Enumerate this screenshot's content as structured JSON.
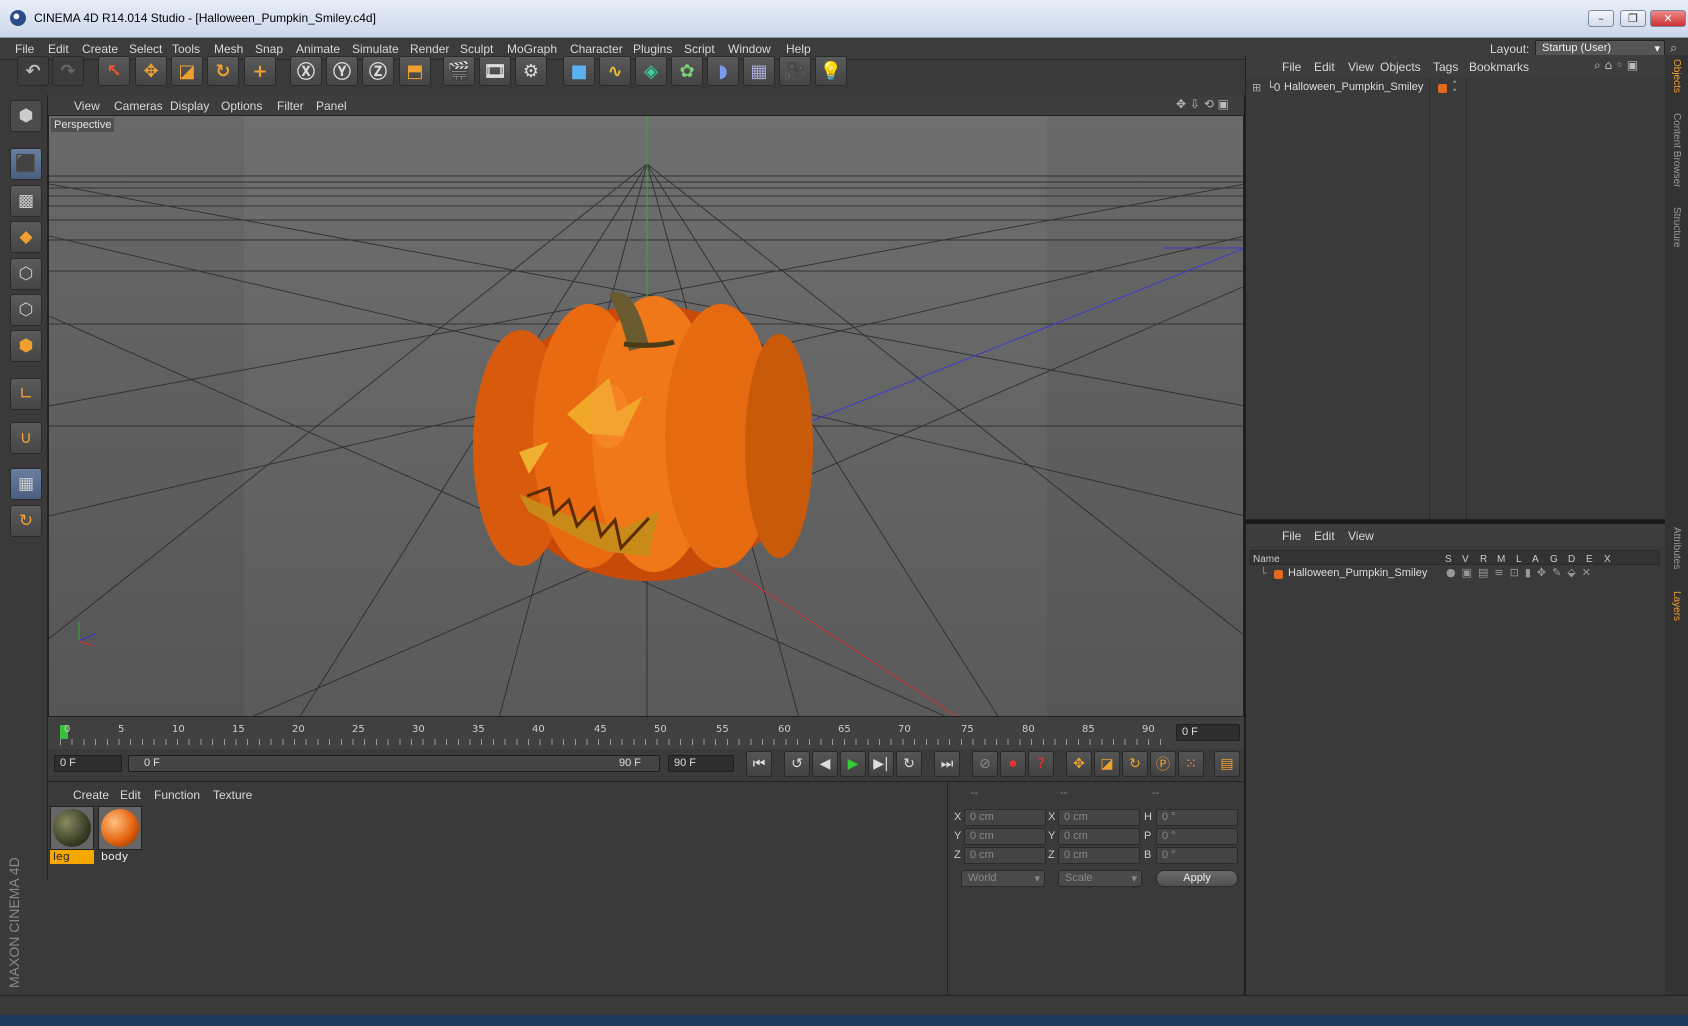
{
  "window": {
    "title": "CINEMA 4D R14.014 Studio - [Halloween_Pumpkin_Smiley.c4d]",
    "controls": [
      "minimize",
      "restore",
      "close"
    ]
  },
  "menubar": {
    "items": [
      "File",
      "Edit",
      "Create",
      "Select",
      "Tools",
      "Mesh",
      "Snap",
      "Animate",
      "Simulate",
      "Render",
      "Sculpt",
      "MoGraph",
      "Character",
      "Plugins",
      "Script",
      "Window",
      "Help"
    ],
    "layout_label": "Layout:",
    "layout_value": "Startup (User)"
  },
  "viewport": {
    "menu": [
      "View",
      "Cameras",
      "Display",
      "Options",
      "Filter",
      "Panel"
    ],
    "label": "Perspective"
  },
  "timeline": {
    "ticks": [
      "0",
      "5",
      "10",
      "15",
      "20",
      "25",
      "30",
      "35",
      "40",
      "45",
      "50",
      "55",
      "60",
      "65",
      "70",
      "75",
      "80",
      "85",
      "90"
    ],
    "current_frame": "0 F",
    "start_field": "0 F",
    "range_start": "0 F",
    "range_end": "90 F",
    "end_field": "90 F"
  },
  "materials": {
    "menu": [
      "Create",
      "Edit",
      "Function",
      "Texture"
    ],
    "items": [
      {
        "name": "leg",
        "selected": true,
        "color": "#3a3f28"
      },
      {
        "name": "body",
        "selected": false,
        "color": "#e5640f"
      }
    ]
  },
  "coordinates": {
    "headers": [
      "--",
      "--",
      "--"
    ],
    "rows": [
      {
        "l1": "X",
        "v1": "0 cm",
        "l2": "X",
        "v2": "0 cm",
        "l3": "H",
        "v3": "0 °"
      },
      {
        "l1": "Y",
        "v1": "0 cm",
        "l2": "Y",
        "v2": "0 cm",
        "l3": "P",
        "v3": "0 °"
      },
      {
        "l1": "Z",
        "v1": "0 cm",
        "l2": "Z",
        "v2": "0 cm",
        "l3": "B",
        "v3": "0 °"
      }
    ],
    "mode": "World",
    "transform": "Scale",
    "apply_label": "Apply"
  },
  "objects": {
    "menu": [
      "File",
      "Edit",
      "View",
      "Objects",
      "Tags",
      "Bookmarks"
    ],
    "items": [
      {
        "name": "Halloween_Pumpkin_Smiley",
        "color": "#e06a20"
      }
    ]
  },
  "layers": {
    "menu": [
      "File",
      "Edit",
      "View"
    ],
    "columns": [
      "Name",
      "S",
      "V",
      "R",
      "M",
      "L",
      "A",
      "G",
      "D",
      "E",
      "X"
    ],
    "items": [
      {
        "name": "Halloween_Pumpkin_Smiley",
        "color": "#e06a20"
      }
    ]
  },
  "side_tabs": {
    "top": [
      "Objects",
      "Content Browser",
      "Structure"
    ],
    "bottom": [
      "Attributes",
      "Layers"
    ]
  },
  "branding": "MAXON CINEMA 4D",
  "colors": {
    "accent": "#f0a030",
    "selection": "#f7a800",
    "pumpkin": "#e5640f"
  }
}
